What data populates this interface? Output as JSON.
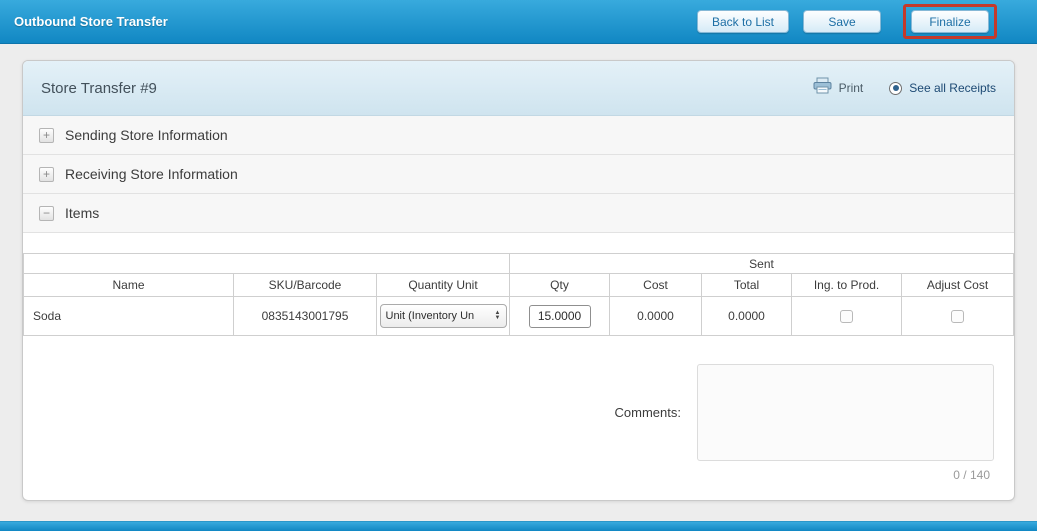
{
  "header": {
    "title": "Outbound Store Transfer",
    "back_to_list_label": "Back to List",
    "save_label": "Save",
    "finalize_label": "Finalize"
  },
  "panel": {
    "title": "Store Transfer #9",
    "print_label": "Print",
    "see_all_receipts_label": "See all Receipts",
    "see_all_receipts_selected": true
  },
  "sections": [
    {
      "label": "Sending Store Information",
      "toggle": "+",
      "expanded": false
    },
    {
      "label": "Receiving Store Information",
      "toggle": "+",
      "expanded": false
    },
    {
      "label": "Items",
      "toggle": "−",
      "expanded": true
    }
  ],
  "items_table": {
    "sent_group_label": "Sent",
    "columns": [
      "Name",
      "SKU/Barcode",
      "Quantity Unit",
      "Qty",
      "Cost",
      "Total",
      "Ing. to Prod.",
      "Adjust Cost"
    ],
    "rows": [
      {
        "name": "Soda",
        "sku": "0835143001795",
        "quantity_unit": "Unit (Inventory Un",
        "qty": "15.0000",
        "cost": "0.0000",
        "total": "0.0000",
        "ing_to_prod_checked": false,
        "adjust_cost_checked": false
      }
    ]
  },
  "comments": {
    "label": "Comments:",
    "value": "",
    "counter": "0 / 140"
  },
  "icons": {
    "print": "print-icon",
    "expand": "plus-icon",
    "collapse": "minus-icon",
    "select_arrows": "up-down-arrows-icon"
  },
  "colors": {
    "topbar_blue_top": "#38aadd",
    "topbar_blue_bottom": "#1187c3",
    "button_text_blue": "#1d6fa5",
    "panel_header_blue": "#d8eaf4",
    "annotation_red": "#c4392b"
  }
}
